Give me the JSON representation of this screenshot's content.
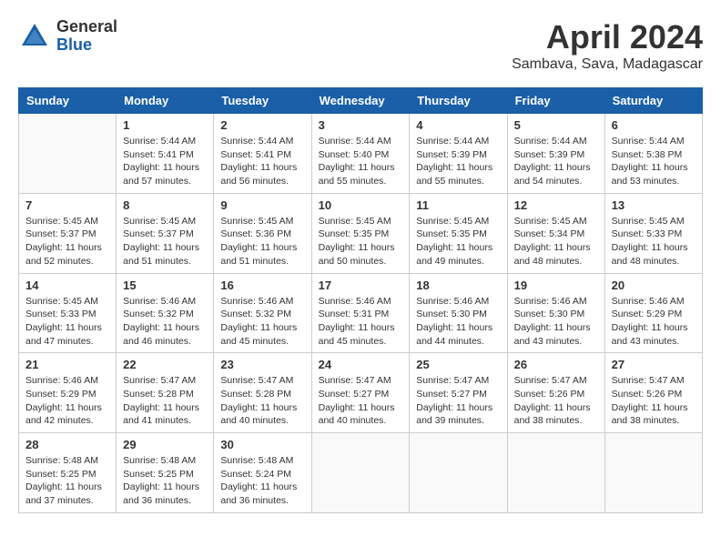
{
  "header": {
    "logo": {
      "general": "General",
      "blue": "Blue"
    },
    "title": "April 2024",
    "location": "Sambava, Sava, Madagascar"
  },
  "days_of_week": [
    "Sunday",
    "Monday",
    "Tuesday",
    "Wednesday",
    "Thursday",
    "Friday",
    "Saturday"
  ],
  "weeks": [
    [
      {
        "day": "",
        "info": ""
      },
      {
        "day": "1",
        "info": "Sunrise: 5:44 AM\nSunset: 5:41 PM\nDaylight: 11 hours\nand 57 minutes."
      },
      {
        "day": "2",
        "info": "Sunrise: 5:44 AM\nSunset: 5:41 PM\nDaylight: 11 hours\nand 56 minutes."
      },
      {
        "day": "3",
        "info": "Sunrise: 5:44 AM\nSunset: 5:40 PM\nDaylight: 11 hours\nand 55 minutes."
      },
      {
        "day": "4",
        "info": "Sunrise: 5:44 AM\nSunset: 5:39 PM\nDaylight: 11 hours\nand 55 minutes."
      },
      {
        "day": "5",
        "info": "Sunrise: 5:44 AM\nSunset: 5:39 PM\nDaylight: 11 hours\nand 54 minutes."
      },
      {
        "day": "6",
        "info": "Sunrise: 5:44 AM\nSunset: 5:38 PM\nDaylight: 11 hours\nand 53 minutes."
      }
    ],
    [
      {
        "day": "7",
        "info": "Sunrise: 5:45 AM\nSunset: 5:37 PM\nDaylight: 11 hours\nand 52 minutes."
      },
      {
        "day": "8",
        "info": "Sunrise: 5:45 AM\nSunset: 5:37 PM\nDaylight: 11 hours\nand 51 minutes."
      },
      {
        "day": "9",
        "info": "Sunrise: 5:45 AM\nSunset: 5:36 PM\nDaylight: 11 hours\nand 51 minutes."
      },
      {
        "day": "10",
        "info": "Sunrise: 5:45 AM\nSunset: 5:35 PM\nDaylight: 11 hours\nand 50 minutes."
      },
      {
        "day": "11",
        "info": "Sunrise: 5:45 AM\nSunset: 5:35 PM\nDaylight: 11 hours\nand 49 minutes."
      },
      {
        "day": "12",
        "info": "Sunrise: 5:45 AM\nSunset: 5:34 PM\nDaylight: 11 hours\nand 48 minutes."
      },
      {
        "day": "13",
        "info": "Sunrise: 5:45 AM\nSunset: 5:33 PM\nDaylight: 11 hours\nand 48 minutes."
      }
    ],
    [
      {
        "day": "14",
        "info": "Sunrise: 5:45 AM\nSunset: 5:33 PM\nDaylight: 11 hours\nand 47 minutes."
      },
      {
        "day": "15",
        "info": "Sunrise: 5:46 AM\nSunset: 5:32 PM\nDaylight: 11 hours\nand 46 minutes."
      },
      {
        "day": "16",
        "info": "Sunrise: 5:46 AM\nSunset: 5:32 PM\nDaylight: 11 hours\nand 45 minutes."
      },
      {
        "day": "17",
        "info": "Sunrise: 5:46 AM\nSunset: 5:31 PM\nDaylight: 11 hours\nand 45 minutes."
      },
      {
        "day": "18",
        "info": "Sunrise: 5:46 AM\nSunset: 5:30 PM\nDaylight: 11 hours\nand 44 minutes."
      },
      {
        "day": "19",
        "info": "Sunrise: 5:46 AM\nSunset: 5:30 PM\nDaylight: 11 hours\nand 43 minutes."
      },
      {
        "day": "20",
        "info": "Sunrise: 5:46 AM\nSunset: 5:29 PM\nDaylight: 11 hours\nand 43 minutes."
      }
    ],
    [
      {
        "day": "21",
        "info": "Sunrise: 5:46 AM\nSunset: 5:29 PM\nDaylight: 11 hours\nand 42 minutes."
      },
      {
        "day": "22",
        "info": "Sunrise: 5:47 AM\nSunset: 5:28 PM\nDaylight: 11 hours\nand 41 minutes."
      },
      {
        "day": "23",
        "info": "Sunrise: 5:47 AM\nSunset: 5:28 PM\nDaylight: 11 hours\nand 40 minutes."
      },
      {
        "day": "24",
        "info": "Sunrise: 5:47 AM\nSunset: 5:27 PM\nDaylight: 11 hours\nand 40 minutes."
      },
      {
        "day": "25",
        "info": "Sunrise: 5:47 AM\nSunset: 5:27 PM\nDaylight: 11 hours\nand 39 minutes."
      },
      {
        "day": "26",
        "info": "Sunrise: 5:47 AM\nSunset: 5:26 PM\nDaylight: 11 hours\nand 38 minutes."
      },
      {
        "day": "27",
        "info": "Sunrise: 5:47 AM\nSunset: 5:26 PM\nDaylight: 11 hours\nand 38 minutes."
      }
    ],
    [
      {
        "day": "28",
        "info": "Sunrise: 5:48 AM\nSunset: 5:25 PM\nDaylight: 11 hours\nand 37 minutes."
      },
      {
        "day": "29",
        "info": "Sunrise: 5:48 AM\nSunset: 5:25 PM\nDaylight: 11 hours\nand 36 minutes."
      },
      {
        "day": "30",
        "info": "Sunrise: 5:48 AM\nSunset: 5:24 PM\nDaylight: 11 hours\nand 36 minutes."
      },
      {
        "day": "",
        "info": ""
      },
      {
        "day": "",
        "info": ""
      },
      {
        "day": "",
        "info": ""
      },
      {
        "day": "",
        "info": ""
      }
    ]
  ]
}
